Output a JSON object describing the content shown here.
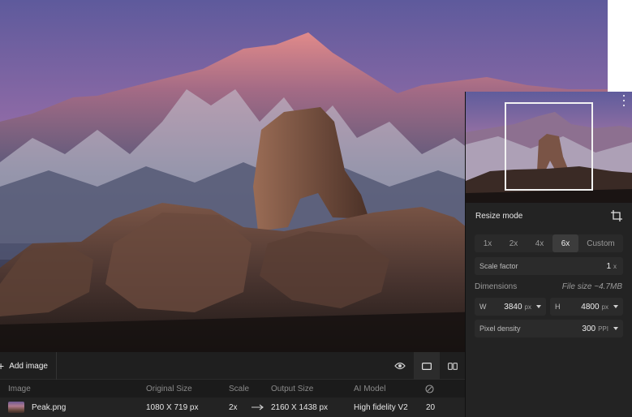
{
  "toolbar": {
    "add_image_label": "Add image"
  },
  "table": {
    "columns": [
      "Image",
      "Original Size",
      "Scale",
      "Output Size",
      "AI Model"
    ],
    "rows": [
      {
        "image": "Peak.png",
        "original_size": "1080 X 719 px",
        "scale": "2x",
        "output_size": "2160 X 1438 px",
        "ai_model": "High fidelity V2",
        "count": "20"
      }
    ]
  },
  "panel": {
    "resize_mode_title": "Resize mode",
    "modes": [
      "1x",
      "2x",
      "4x",
      "6x",
      "Custom"
    ],
    "active_mode": "6x",
    "scale_factor_label": "Scale factor",
    "scale_factor_value": "1",
    "scale_factor_unit": "x",
    "dimensions_title": "Dimensions",
    "file_size": "File size ~4.7MB",
    "width_label": "W",
    "width_value": "3840",
    "width_unit": "px",
    "height_label": "H",
    "height_value": "4800",
    "height_unit": "px",
    "pixel_density_label": "Pixel density",
    "pixel_density_value": "300",
    "pixel_density_unit": "PPI"
  },
  "icons": [
    "plus-icon",
    "eye-icon",
    "single-view-icon",
    "split-view-icon",
    "settings-icon",
    "arrow-right-icon",
    "crop-icon",
    "kebab-menu-icon",
    "caret-down-icon"
  ],
  "colors": {
    "panel_bg": "#232323",
    "bar_bg": "#1b1b1b",
    "accent_white": "#f2f2f2"
  }
}
